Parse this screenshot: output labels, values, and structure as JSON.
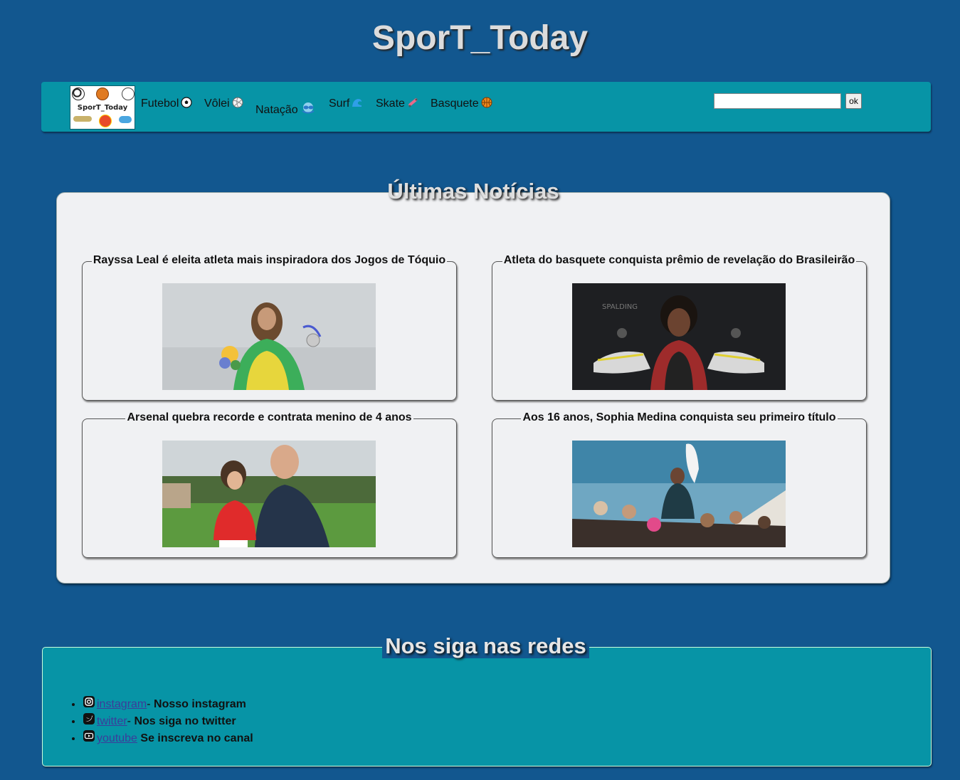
{
  "site": {
    "title": "SporT_Today",
    "logo_text": "SporT_Today"
  },
  "nav": {
    "items": [
      {
        "label": "Futebol",
        "icon": "soccer-ball-icon"
      },
      {
        "label": "Vôlei",
        "icon": "volleyball-icon"
      },
      {
        "label": "Natação",
        "icon": "swim-goggles-icon"
      },
      {
        "label": "Surf",
        "icon": "wave-icon"
      },
      {
        "label": "Skate",
        "icon": "skateboard-icon"
      },
      {
        "label": "Basquete",
        "icon": "basketball-icon"
      }
    ],
    "search": {
      "value": "",
      "button_label": "ok"
    }
  },
  "news": {
    "heading": "Últimas Notícias",
    "cards": [
      {
        "title": "Rayssa Leal é eleita atleta mais inspiradora dos Jogos de Tóquio",
        "image": "athlete-with-medal-photo"
      },
      {
        "title": "Atleta do basquete conquista prêmio de revelação do Brasileirão",
        "image": "basketball-player-with-shoes-photo"
      },
      {
        "title": "Arsenal quebra recorde e contrata menino de 4 anos",
        "image": "boy-in-arsenal-kit-photo"
      },
      {
        "title": "Aos 16 anos, Sophia Medina conquista seu primeiro título",
        "image": "surfer-celebration-photo"
      }
    ]
  },
  "social": {
    "heading": "Nos siga nas redes",
    "items": [
      {
        "link": "instagram",
        "sep": "- ",
        "text": "Nosso instagram",
        "icon": "instagram-icon"
      },
      {
        "link": "twitter",
        "sep": "- ",
        "text": "Nos siga no twitter",
        "icon": "twitter-icon"
      },
      {
        "link": "youtube",
        "sep": " ",
        "text": "Se inscreva no canal",
        "icon": "youtube-icon"
      }
    ]
  },
  "colors": {
    "page_bg": "#12578f",
    "bar_bg": "#0794a6",
    "card_bg": "#f0f1f3"
  }
}
